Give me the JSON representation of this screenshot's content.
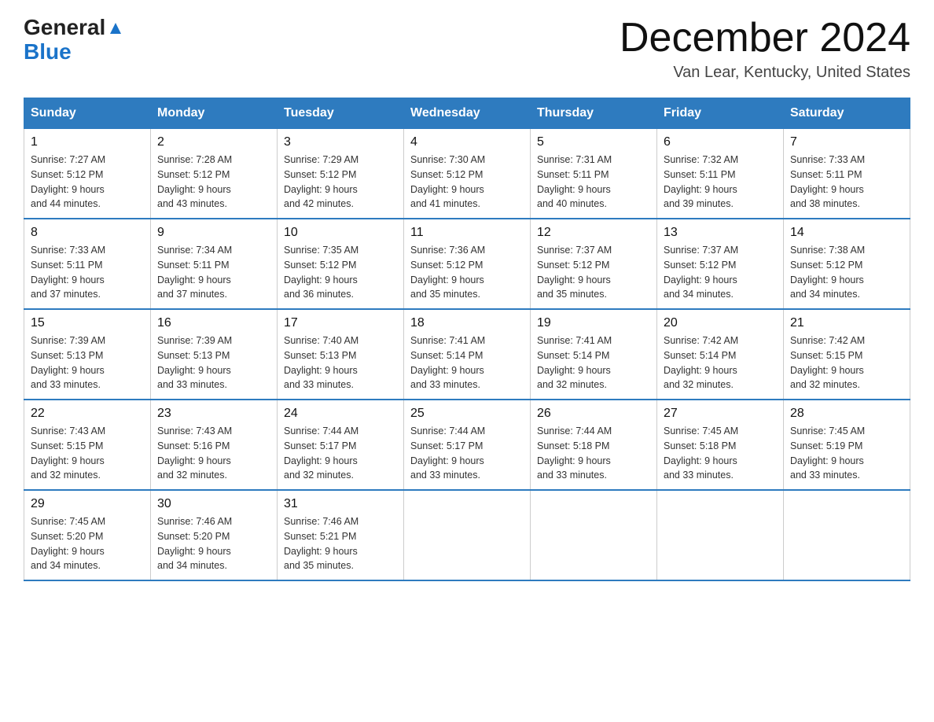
{
  "logo": {
    "text_general": "General",
    "triangle": "▲",
    "text_blue": "Blue"
  },
  "title": "December 2024",
  "location": "Van Lear, Kentucky, United States",
  "days_of_week": [
    "Sunday",
    "Monday",
    "Tuesday",
    "Wednesday",
    "Thursday",
    "Friday",
    "Saturday"
  ],
  "weeks": [
    [
      {
        "day": "1",
        "sunrise": "7:27 AM",
        "sunset": "5:12 PM",
        "daylight": "9 hours and 44 minutes."
      },
      {
        "day": "2",
        "sunrise": "7:28 AM",
        "sunset": "5:12 PM",
        "daylight": "9 hours and 43 minutes."
      },
      {
        "day": "3",
        "sunrise": "7:29 AM",
        "sunset": "5:12 PM",
        "daylight": "9 hours and 42 minutes."
      },
      {
        "day": "4",
        "sunrise": "7:30 AM",
        "sunset": "5:12 PM",
        "daylight": "9 hours and 41 minutes."
      },
      {
        "day": "5",
        "sunrise": "7:31 AM",
        "sunset": "5:11 PM",
        "daylight": "9 hours and 40 minutes."
      },
      {
        "day": "6",
        "sunrise": "7:32 AM",
        "sunset": "5:11 PM",
        "daylight": "9 hours and 39 minutes."
      },
      {
        "day": "7",
        "sunrise": "7:33 AM",
        "sunset": "5:11 PM",
        "daylight": "9 hours and 38 minutes."
      }
    ],
    [
      {
        "day": "8",
        "sunrise": "7:33 AM",
        "sunset": "5:11 PM",
        "daylight": "9 hours and 37 minutes."
      },
      {
        "day": "9",
        "sunrise": "7:34 AM",
        "sunset": "5:11 PM",
        "daylight": "9 hours and 37 minutes."
      },
      {
        "day": "10",
        "sunrise": "7:35 AM",
        "sunset": "5:12 PM",
        "daylight": "9 hours and 36 minutes."
      },
      {
        "day": "11",
        "sunrise": "7:36 AM",
        "sunset": "5:12 PM",
        "daylight": "9 hours and 35 minutes."
      },
      {
        "day": "12",
        "sunrise": "7:37 AM",
        "sunset": "5:12 PM",
        "daylight": "9 hours and 35 minutes."
      },
      {
        "day": "13",
        "sunrise": "7:37 AM",
        "sunset": "5:12 PM",
        "daylight": "9 hours and 34 minutes."
      },
      {
        "day": "14",
        "sunrise": "7:38 AM",
        "sunset": "5:12 PM",
        "daylight": "9 hours and 34 minutes."
      }
    ],
    [
      {
        "day": "15",
        "sunrise": "7:39 AM",
        "sunset": "5:13 PM",
        "daylight": "9 hours and 33 minutes."
      },
      {
        "day": "16",
        "sunrise": "7:39 AM",
        "sunset": "5:13 PM",
        "daylight": "9 hours and 33 minutes."
      },
      {
        "day": "17",
        "sunrise": "7:40 AM",
        "sunset": "5:13 PM",
        "daylight": "9 hours and 33 minutes."
      },
      {
        "day": "18",
        "sunrise": "7:41 AM",
        "sunset": "5:14 PM",
        "daylight": "9 hours and 33 minutes."
      },
      {
        "day": "19",
        "sunrise": "7:41 AM",
        "sunset": "5:14 PM",
        "daylight": "9 hours and 32 minutes."
      },
      {
        "day": "20",
        "sunrise": "7:42 AM",
        "sunset": "5:14 PM",
        "daylight": "9 hours and 32 minutes."
      },
      {
        "day": "21",
        "sunrise": "7:42 AM",
        "sunset": "5:15 PM",
        "daylight": "9 hours and 32 minutes."
      }
    ],
    [
      {
        "day": "22",
        "sunrise": "7:43 AM",
        "sunset": "5:15 PM",
        "daylight": "9 hours and 32 minutes."
      },
      {
        "day": "23",
        "sunrise": "7:43 AM",
        "sunset": "5:16 PM",
        "daylight": "9 hours and 32 minutes."
      },
      {
        "day": "24",
        "sunrise": "7:44 AM",
        "sunset": "5:17 PM",
        "daylight": "9 hours and 32 minutes."
      },
      {
        "day": "25",
        "sunrise": "7:44 AM",
        "sunset": "5:17 PM",
        "daylight": "9 hours and 33 minutes."
      },
      {
        "day": "26",
        "sunrise": "7:44 AM",
        "sunset": "5:18 PM",
        "daylight": "9 hours and 33 minutes."
      },
      {
        "day": "27",
        "sunrise": "7:45 AM",
        "sunset": "5:18 PM",
        "daylight": "9 hours and 33 minutes."
      },
      {
        "day": "28",
        "sunrise": "7:45 AM",
        "sunset": "5:19 PM",
        "daylight": "9 hours and 33 minutes."
      }
    ],
    [
      {
        "day": "29",
        "sunrise": "7:45 AM",
        "sunset": "5:20 PM",
        "daylight": "9 hours and 34 minutes."
      },
      {
        "day": "30",
        "sunrise": "7:46 AM",
        "sunset": "5:20 PM",
        "daylight": "9 hours and 34 minutes."
      },
      {
        "day": "31",
        "sunrise": "7:46 AM",
        "sunset": "5:21 PM",
        "daylight": "9 hours and 35 minutes."
      },
      null,
      null,
      null,
      null
    ]
  ],
  "labels": {
    "sunrise": "Sunrise:",
    "sunset": "Sunset:",
    "daylight": "Daylight:"
  }
}
